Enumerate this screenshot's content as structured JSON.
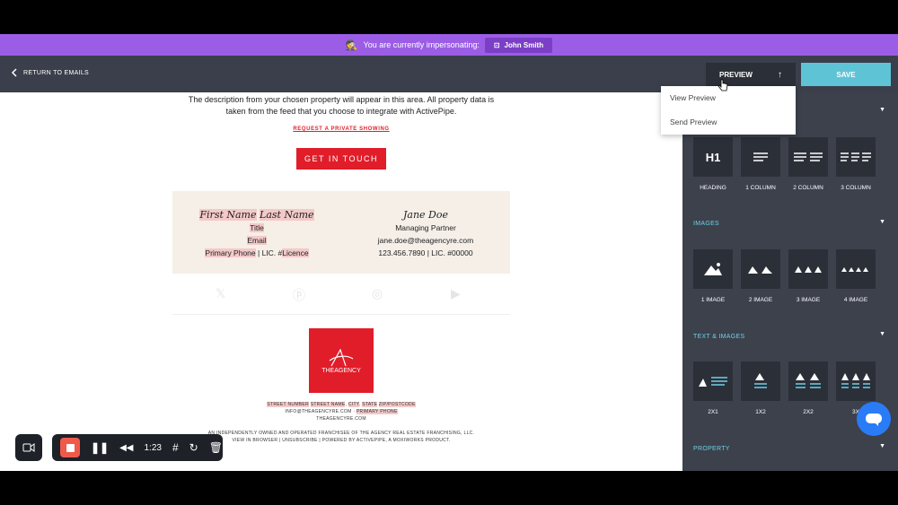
{
  "impersonation": {
    "text": "You are currently impersonating:",
    "user": "John Smith"
  },
  "topbar": {
    "return_label": "RETURN TO EMAILS",
    "preview_label": "PREVIEW",
    "save_label": "SAVE"
  },
  "preview_menu": {
    "items": [
      "View Preview",
      "Send Preview"
    ]
  },
  "email": {
    "description": "The description from your chosen property will appear in this area. All property data is taken from the feed that you choose to integrate with ActivePipe.",
    "request_link": "REQUEST A PRIVATE SHOWING",
    "cta": "GET IN TOUCH",
    "sig_left": {
      "first": "First Name",
      "last": "Last Name",
      "title": "Title",
      "email": "Email",
      "phone": "Primary Phone",
      "sep": " | LIC. #",
      "licence": "Licence"
    },
    "sig_right": {
      "name": "Jane Doe",
      "title": "Managing Partner",
      "email": "jane.doe@theagencyre.com",
      "phone": "123.456.7890 | LIC. #00000"
    },
    "logo_text": "THEAGENCY",
    "address": {
      "street_number": "STREET NUMBER",
      "street_name": "STREET NAME",
      "city": "CITY",
      "state": "STATE",
      "zip": "ZIP/POSTCODE"
    },
    "contact": {
      "email": "INFO@THEAGENCYRE.COM",
      "sep": " · ",
      "phone": "PRIMARY PHONE"
    },
    "website": "THEAGENCYRE.COM",
    "disclaimer": "AN INDEPENDENTLY OWNED AND OPERATED FRANCHISEE OF THE AGENCY REAL ESTATE FRANCHISING, LLC.",
    "footer_links": "VIEW IN BROWSER | UNSUBSCRIBE | POWERED BY ACTIVEPIPE, A MOXIWORKS PRODUCT."
  },
  "sidebar": {
    "layout_tiles": [
      {
        "icon": "H1",
        "label": "HEADING"
      },
      {
        "icon": "1col",
        "label": "1 COLUMN"
      },
      {
        "icon": "2col",
        "label": "2 COLUMN"
      },
      {
        "icon": "3col",
        "label": "3 COLUMN"
      }
    ],
    "images_title": "IMAGES",
    "image_tiles": [
      "1 IMAGE",
      "2 IMAGE",
      "3 IMAGE",
      "4 IMAGE"
    ],
    "text_images_title": "TEXT & IMAGES",
    "text_image_tiles": [
      "2X1",
      "1X2",
      "2X2",
      "3X"
    ],
    "property_title": "PROPERTY"
  },
  "recorder": {
    "time": "1:23"
  },
  "colors": {
    "accent": "#9b5de5",
    "save": "#5fc3d6",
    "brand_red": "#e11d2a",
    "section_title": "#6fd1e6"
  }
}
